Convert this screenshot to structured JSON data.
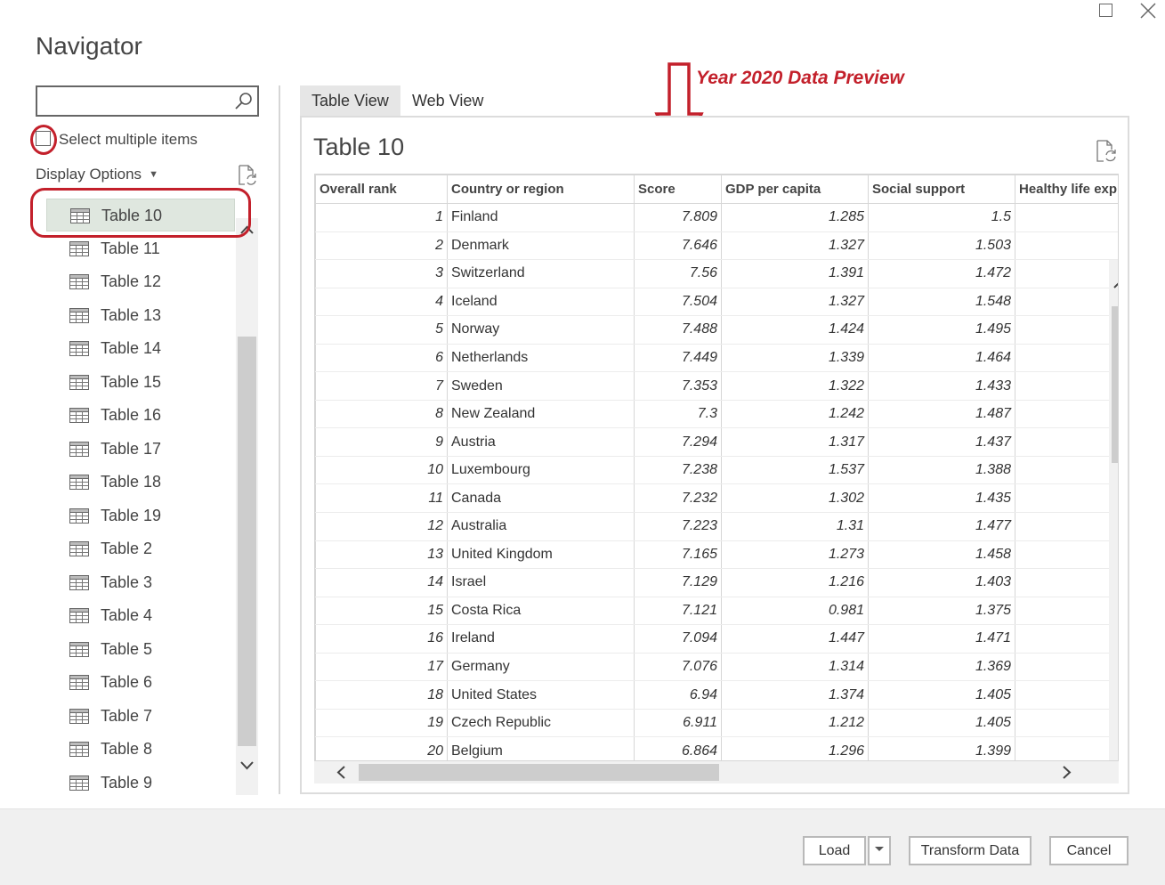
{
  "window": {
    "title": "Navigator"
  },
  "left_pane": {
    "search_value": "",
    "select_multiple_label": "Select multiple items",
    "display_options_label": "Display Options",
    "items": [
      {
        "label": "Table 10",
        "selected": true
      },
      {
        "label": "Table 11"
      },
      {
        "label": "Table 12"
      },
      {
        "label": "Table 13"
      },
      {
        "label": "Table 14"
      },
      {
        "label": "Table 15"
      },
      {
        "label": "Table 16"
      },
      {
        "label": "Table 17"
      },
      {
        "label": "Table 18"
      },
      {
        "label": "Table 19"
      },
      {
        "label": "Table 2"
      },
      {
        "label": "Table 3"
      },
      {
        "label": "Table 4"
      },
      {
        "label": "Table 5"
      },
      {
        "label": "Table 6"
      },
      {
        "label": "Table 7"
      },
      {
        "label": "Table 8"
      },
      {
        "label": "Table 9"
      }
    ]
  },
  "tabs": [
    {
      "label": "Table View",
      "active": true
    },
    {
      "label": "Web View"
    }
  ],
  "annotation": {
    "text": "Year 2020 Data Preview",
    "color": "#c3202b"
  },
  "preview": {
    "title": "Table 10",
    "columns": [
      "Overall rank",
      "Country or region",
      "Score",
      "GDP per capita",
      "Social support",
      "Healthy life exp"
    ],
    "rows": [
      [
        "1",
        "Finland",
        "7.809",
        "1.285",
        "1.5"
      ],
      [
        "2",
        "Denmark",
        "7.646",
        "1.327",
        "1.503"
      ],
      [
        "3",
        "Switzerland",
        "7.56",
        "1.391",
        "1.472"
      ],
      [
        "4",
        "Iceland",
        "7.504",
        "1.327",
        "1.548"
      ],
      [
        "5",
        "Norway",
        "7.488",
        "1.424",
        "1.495"
      ],
      [
        "6",
        "Netherlands",
        "7.449",
        "1.339",
        "1.464"
      ],
      [
        "7",
        "Sweden",
        "7.353",
        "1.322",
        "1.433"
      ],
      [
        "8",
        "New Zealand",
        "7.3",
        "1.242",
        "1.487"
      ],
      [
        "9",
        "Austria",
        "7.294",
        "1.317",
        "1.437"
      ],
      [
        "10",
        "Luxembourg",
        "7.238",
        "1.537",
        "1.388"
      ],
      [
        "11",
        "Canada",
        "7.232",
        "1.302",
        "1.435"
      ],
      [
        "12",
        "Australia",
        "7.223",
        "1.31",
        "1.477"
      ],
      [
        "13",
        "United Kingdom",
        "7.165",
        "1.273",
        "1.458"
      ],
      [
        "14",
        "Israel",
        "7.129",
        "1.216",
        "1.403"
      ],
      [
        "15",
        "Costa Rica",
        "7.121",
        "0.981",
        "1.375"
      ],
      [
        "16",
        "Ireland",
        "7.094",
        "1.447",
        "1.471"
      ],
      [
        "17",
        "Germany",
        "7.076",
        "1.314",
        "1.369"
      ],
      [
        "18",
        "United States",
        "6.94",
        "1.374",
        "1.405"
      ],
      [
        "19",
        "Czech Republic",
        "6.911",
        "1.212",
        "1.405"
      ],
      [
        "20",
        "Belgium",
        "6.864",
        "1.296",
        "1.399"
      ]
    ]
  },
  "footer": {
    "load_label": "Load",
    "transform_label": "Transform Data",
    "cancel_label": "Cancel"
  }
}
